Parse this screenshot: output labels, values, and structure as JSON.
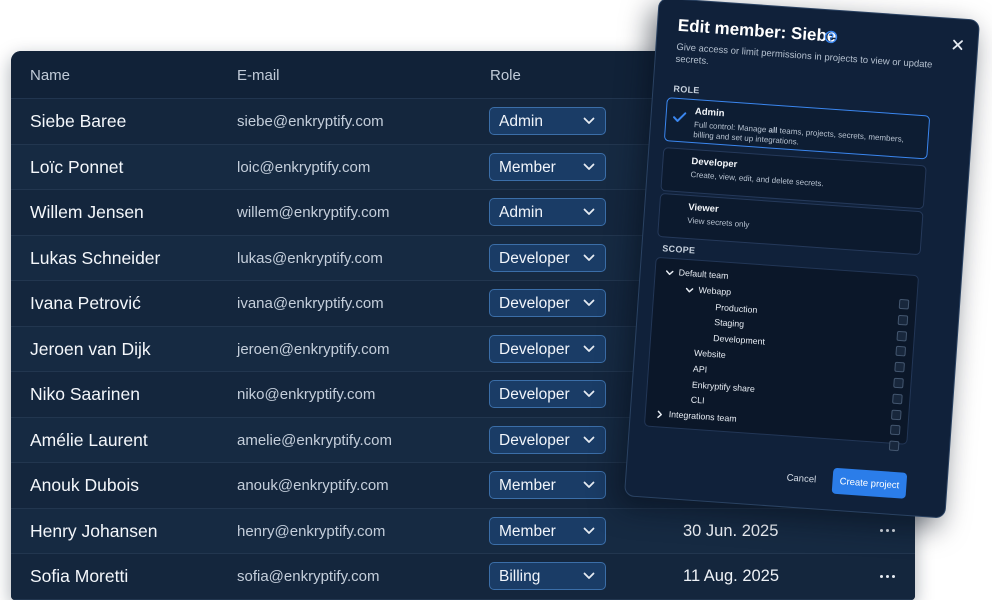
{
  "table": {
    "headers": {
      "name": "Name",
      "email": "E-mail",
      "role": "Role"
    },
    "rows": [
      {
        "name": "Siebe Baree",
        "email": "siebe@enkryptify.com",
        "role": "Admin",
        "date": ""
      },
      {
        "name": "Loïc Ponnet",
        "email": "loic@enkryptify.com",
        "role": "Member",
        "date": ""
      },
      {
        "name": "Willem Jensen",
        "email": "willem@enkryptify.com",
        "role": "Admin",
        "date": ""
      },
      {
        "name": "Lukas Schneider",
        "email": "lukas@enkryptify.com",
        "role": "Developer",
        "date": ""
      },
      {
        "name": "Ivana Petrović",
        "email": "ivana@enkryptify.com",
        "role": "Developer",
        "date": ""
      },
      {
        "name": "Jeroen van Dijk",
        "email": "jeroen@enkryptify.com",
        "role": "Developer",
        "date": ""
      },
      {
        "name": "Niko Saarinen",
        "email": "niko@enkryptify.com",
        "role": "Developer",
        "date": ""
      },
      {
        "name": "Amélie Laurent",
        "email": "amelie@enkryptify.com",
        "role": "Developer",
        "date": ""
      },
      {
        "name": "Anouk Dubois",
        "email": "anouk@enkryptify.com",
        "role": "Member",
        "date": ""
      },
      {
        "name": "Henry Johansen",
        "email": "henry@enkryptify.com",
        "role": "Member",
        "date": "30 Jun. 2025"
      },
      {
        "name": "Sofia Moretti",
        "email": "sofia@enkryptify.com",
        "role": "Billing",
        "date": "11 Aug. 2025"
      }
    ]
  },
  "modal": {
    "title": "Edit member: Siebe",
    "subtitle": "Give access or limit permissions in projects to view or update secrets.",
    "role_heading": "ROLE",
    "roles": [
      {
        "title": "Admin",
        "desc_before": "Full control: Manage ",
        "desc_bold": "all",
        "desc_after": " teams, projects, secrets, members, billing and set up integrations.",
        "selected": true
      },
      {
        "title": "Developer",
        "desc_before": "Create, view, edit, and delete secrets.",
        "desc_bold": "",
        "desc_after": "",
        "selected": false
      },
      {
        "title": "Viewer",
        "desc_before": "View secrets only",
        "desc_bold": "",
        "desc_after": "",
        "selected": false
      }
    ],
    "scope_heading": "SCOPE",
    "scope_tree": [
      {
        "label": "Default team",
        "depth": 0,
        "chevron": "down"
      },
      {
        "label": "Webapp",
        "depth": 1,
        "chevron": "down"
      },
      {
        "label": "Production",
        "depth": 2,
        "chevron": ""
      },
      {
        "label": "Staging",
        "depth": 2,
        "chevron": ""
      },
      {
        "label": "Development",
        "depth": 2,
        "chevron": ""
      },
      {
        "label": "Website",
        "depth": 1,
        "chevron": ""
      },
      {
        "label": "API",
        "depth": 1,
        "chevron": ""
      },
      {
        "label": "Enkryptify share",
        "depth": 1,
        "chevron": ""
      },
      {
        "label": "CLI",
        "depth": 1,
        "chevron": ""
      },
      {
        "label": "Integrations team",
        "depth": 0,
        "chevron": "right"
      }
    ],
    "cancel_label": "Cancel",
    "create_label": "Create project"
  },
  "icons": {
    "help": "help-circle-icon",
    "close": "close-icon",
    "check": "check-icon",
    "select_chevron": "chevron-down-icon",
    "more": "more-horizontal-icon"
  },
  "colors": {
    "accent": "#2b7de9",
    "select_bg": "#1a3c66",
    "table_bg": "#14263d",
    "modal_bg": "#10213a"
  }
}
